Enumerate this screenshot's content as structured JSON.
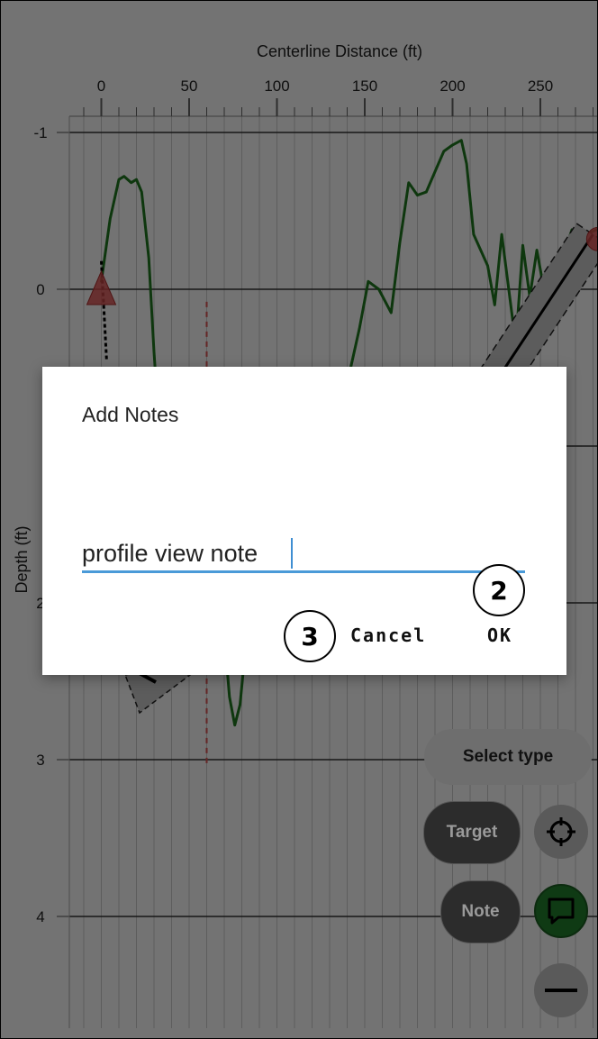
{
  "chart_data": {
    "type": "line",
    "xlabel": "Centerline Distance (ft)",
    "ylabel": "Depth (ft)",
    "x_ticks": [
      0,
      50,
      100,
      150,
      200,
      250
    ],
    "y_ticks": [
      -1,
      0,
      1,
      2,
      3,
      4
    ],
    "y_tick_labels_visible": [
      "-1",
      "0",
      "2",
      "3",
      "4"
    ],
    "xlim": [
      -18,
      285
    ],
    "ylim": [
      -1.1,
      4.6
    ],
    "grid": true,
    "series": [
      {
        "color": "#1f7a1f",
        "x": [
          0,
          5,
          10,
          13,
          17,
          20,
          23,
          27,
          30,
          33,
          36
        ],
        "y": [
          -0.05,
          -0.45,
          -0.7,
          -0.72,
          -0.68,
          -0.7,
          -0.62,
          -0.2,
          0.4,
          0.9,
          1.2
        ]
      },
      {
        "color": "#1f7a1f",
        "x": [
          142,
          147,
          152,
          158,
          165,
          170,
          175,
          180,
          185,
          190,
          195,
          200,
          205,
          208,
          212,
          216,
          220,
          224,
          228,
          232,
          236,
          240,
          244,
          248,
          252,
          256,
          260,
          264,
          268,
          272,
          276,
          282
        ],
        "y": [
          0.5,
          0.25,
          -0.05,
          0.0,
          0.15,
          -0.3,
          -0.68,
          -0.6,
          -0.62,
          -0.75,
          -0.88,
          -0.92,
          -0.95,
          -0.8,
          -0.35,
          -0.25,
          -0.15,
          0.1,
          -0.35,
          0.0,
          0.35,
          -0.28,
          0.05,
          -0.25,
          0.0,
          0.05,
          -0.1,
          -0.25,
          -0.38,
          -0.32,
          -0.35,
          -0.38
        ]
      },
      {
        "color": "#1f7a1f",
        "x": [
          70,
          73,
          76,
          79,
          82,
          85
        ],
        "y": [
          2.2,
          2.6,
          2.78,
          2.65,
          2.3,
          2.0
        ]
      }
    ],
    "bore_line": {
      "color": "#000000",
      "x": [
        224,
        280
      ],
      "y": [
        0.6,
        -0.35
      ]
    },
    "entry_marker": {
      "shape": "triangle",
      "color": "#e05050",
      "x": 0,
      "y": 0
    },
    "exit_marker": {
      "shape": "circle",
      "color": "#e05050",
      "x": 283,
      "y": -0.32
    },
    "reference_line": {
      "color": "#e05555",
      "x": 60,
      "y_from": 0.08,
      "y_to": 3.05
    }
  },
  "controls": {
    "select_type": "Select type",
    "target": "Target",
    "note": "Note"
  },
  "dialog": {
    "title": "Add Notes",
    "input_value": "profile view note",
    "cancel": "Cancel",
    "ok": "OK"
  },
  "annotations": {
    "step_ok": "2",
    "step_cancel": "3"
  }
}
